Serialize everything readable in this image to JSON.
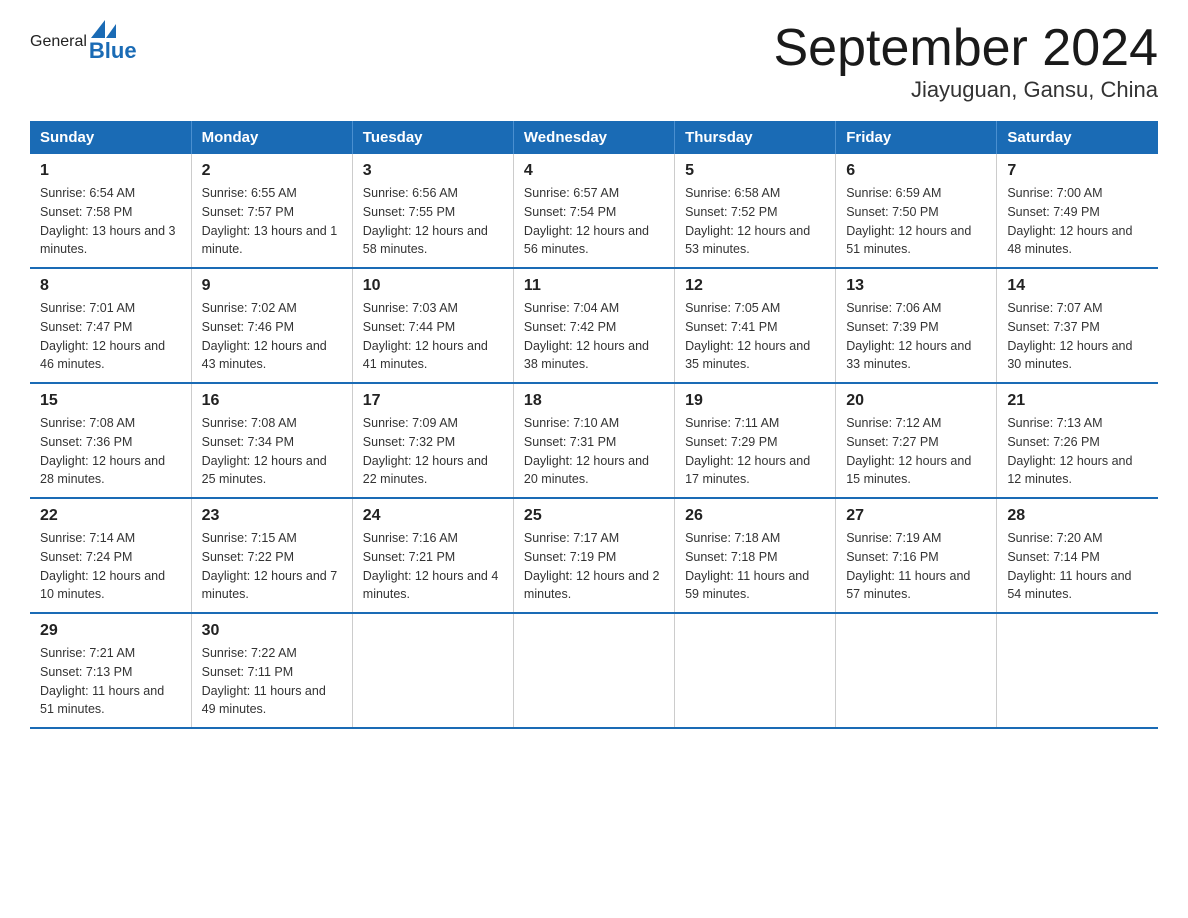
{
  "header": {
    "logo_general": "General",
    "logo_blue": "Blue",
    "title": "September 2024",
    "subtitle": "Jiayuguan, Gansu, China"
  },
  "days_of_week": [
    "Sunday",
    "Monday",
    "Tuesday",
    "Wednesday",
    "Thursday",
    "Friday",
    "Saturday"
  ],
  "weeks": [
    [
      {
        "day": "1",
        "sunrise": "6:54 AM",
        "sunset": "7:58 PM",
        "daylight": "13 hours and 3 minutes."
      },
      {
        "day": "2",
        "sunrise": "6:55 AM",
        "sunset": "7:57 PM",
        "daylight": "13 hours and 1 minute."
      },
      {
        "day": "3",
        "sunrise": "6:56 AM",
        "sunset": "7:55 PM",
        "daylight": "12 hours and 58 minutes."
      },
      {
        "day": "4",
        "sunrise": "6:57 AM",
        "sunset": "7:54 PM",
        "daylight": "12 hours and 56 minutes."
      },
      {
        "day": "5",
        "sunrise": "6:58 AM",
        "sunset": "7:52 PM",
        "daylight": "12 hours and 53 minutes."
      },
      {
        "day": "6",
        "sunrise": "6:59 AM",
        "sunset": "7:50 PM",
        "daylight": "12 hours and 51 minutes."
      },
      {
        "day": "7",
        "sunrise": "7:00 AM",
        "sunset": "7:49 PM",
        "daylight": "12 hours and 48 minutes."
      }
    ],
    [
      {
        "day": "8",
        "sunrise": "7:01 AM",
        "sunset": "7:47 PM",
        "daylight": "12 hours and 46 minutes."
      },
      {
        "day": "9",
        "sunrise": "7:02 AM",
        "sunset": "7:46 PM",
        "daylight": "12 hours and 43 minutes."
      },
      {
        "day": "10",
        "sunrise": "7:03 AM",
        "sunset": "7:44 PM",
        "daylight": "12 hours and 41 minutes."
      },
      {
        "day": "11",
        "sunrise": "7:04 AM",
        "sunset": "7:42 PM",
        "daylight": "12 hours and 38 minutes."
      },
      {
        "day": "12",
        "sunrise": "7:05 AM",
        "sunset": "7:41 PM",
        "daylight": "12 hours and 35 minutes."
      },
      {
        "day": "13",
        "sunrise": "7:06 AM",
        "sunset": "7:39 PM",
        "daylight": "12 hours and 33 minutes."
      },
      {
        "day": "14",
        "sunrise": "7:07 AM",
        "sunset": "7:37 PM",
        "daylight": "12 hours and 30 minutes."
      }
    ],
    [
      {
        "day": "15",
        "sunrise": "7:08 AM",
        "sunset": "7:36 PM",
        "daylight": "12 hours and 28 minutes."
      },
      {
        "day": "16",
        "sunrise": "7:08 AM",
        "sunset": "7:34 PM",
        "daylight": "12 hours and 25 minutes."
      },
      {
        "day": "17",
        "sunrise": "7:09 AM",
        "sunset": "7:32 PM",
        "daylight": "12 hours and 22 minutes."
      },
      {
        "day": "18",
        "sunrise": "7:10 AM",
        "sunset": "7:31 PM",
        "daylight": "12 hours and 20 minutes."
      },
      {
        "day": "19",
        "sunrise": "7:11 AM",
        "sunset": "7:29 PM",
        "daylight": "12 hours and 17 minutes."
      },
      {
        "day": "20",
        "sunrise": "7:12 AM",
        "sunset": "7:27 PM",
        "daylight": "12 hours and 15 minutes."
      },
      {
        "day": "21",
        "sunrise": "7:13 AM",
        "sunset": "7:26 PM",
        "daylight": "12 hours and 12 minutes."
      }
    ],
    [
      {
        "day": "22",
        "sunrise": "7:14 AM",
        "sunset": "7:24 PM",
        "daylight": "12 hours and 10 minutes."
      },
      {
        "day": "23",
        "sunrise": "7:15 AM",
        "sunset": "7:22 PM",
        "daylight": "12 hours and 7 minutes."
      },
      {
        "day": "24",
        "sunrise": "7:16 AM",
        "sunset": "7:21 PM",
        "daylight": "12 hours and 4 minutes."
      },
      {
        "day": "25",
        "sunrise": "7:17 AM",
        "sunset": "7:19 PM",
        "daylight": "12 hours and 2 minutes."
      },
      {
        "day": "26",
        "sunrise": "7:18 AM",
        "sunset": "7:18 PM",
        "daylight": "11 hours and 59 minutes."
      },
      {
        "day": "27",
        "sunrise": "7:19 AM",
        "sunset": "7:16 PM",
        "daylight": "11 hours and 57 minutes."
      },
      {
        "day": "28",
        "sunrise": "7:20 AM",
        "sunset": "7:14 PM",
        "daylight": "11 hours and 54 minutes."
      }
    ],
    [
      {
        "day": "29",
        "sunrise": "7:21 AM",
        "sunset": "7:13 PM",
        "daylight": "11 hours and 51 minutes."
      },
      {
        "day": "30",
        "sunrise": "7:22 AM",
        "sunset": "7:11 PM",
        "daylight": "11 hours and 49 minutes."
      },
      {
        "day": "",
        "sunrise": "",
        "sunset": "",
        "daylight": ""
      },
      {
        "day": "",
        "sunrise": "",
        "sunset": "",
        "daylight": ""
      },
      {
        "day": "",
        "sunrise": "",
        "sunset": "",
        "daylight": ""
      },
      {
        "day": "",
        "sunrise": "",
        "sunset": "",
        "daylight": ""
      },
      {
        "day": "",
        "sunrise": "",
        "sunset": "",
        "daylight": ""
      }
    ]
  ]
}
